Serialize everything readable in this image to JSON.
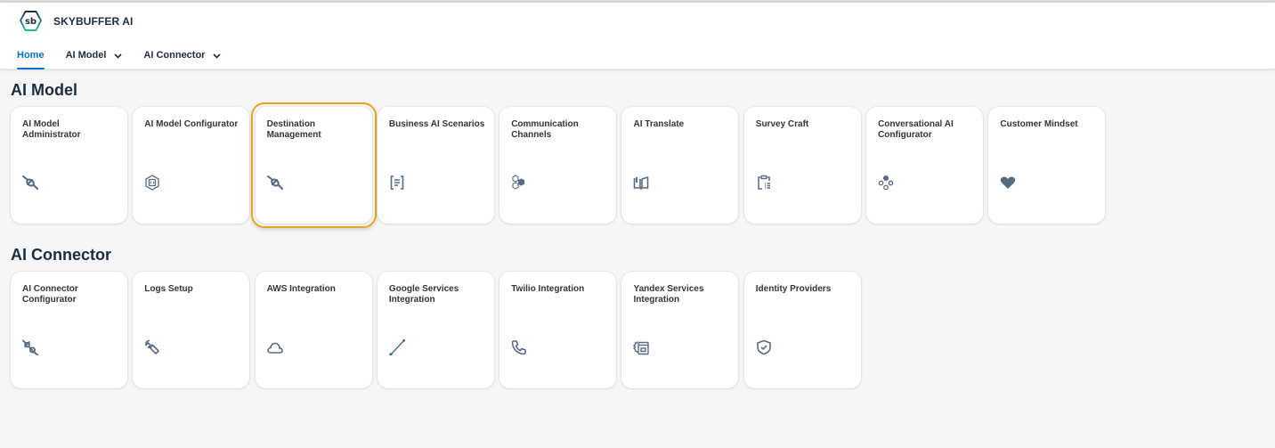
{
  "app": {
    "title": "SKYBUFFER AI",
    "logo_text": "sb"
  },
  "nav": {
    "items": [
      {
        "label": "Home",
        "active": true,
        "has_menu": false
      },
      {
        "label": "AI Model",
        "active": false,
        "has_menu": true
      },
      {
        "label": "AI Connector",
        "active": false,
        "has_menu": true
      }
    ]
  },
  "colors": {
    "accent": "#0a6ed1",
    "focus": "#e9a41c",
    "icon": "#556b82",
    "text": "#1d2d3e",
    "background": "#f5f6f7",
    "tile": "#ffffff"
  },
  "sections": [
    {
      "title": "AI Model",
      "tiles": [
        {
          "title": "AI Model Administrator",
          "icon": "plug-disconnected-icon"
        },
        {
          "title": "AI Model Configurator",
          "icon": "hexagon-code-icon"
        },
        {
          "title": "Destination Management",
          "icon": "plug-disconnected-icon",
          "focused": true
        },
        {
          "title": "Business AI Scenarios",
          "icon": "document-text-bracket-icon"
        },
        {
          "title": "Communication Channels",
          "icon": "hexagons-network-icon"
        },
        {
          "title": "AI Translate",
          "icon": "open-book-icon"
        },
        {
          "title": "Survey Craft",
          "icon": "clipboard-list-icon"
        },
        {
          "title": "Conversational AI Configurator",
          "icon": "nodes-cluster-icon"
        },
        {
          "title": "Customer Mindset",
          "icon": "heart-icon"
        }
      ]
    },
    {
      "title": "AI Connector",
      "tiles": [
        {
          "title": "AI Connector Configurator",
          "icon": "plug-connected-icon"
        },
        {
          "title": "Logs Setup",
          "icon": "wrench-icon"
        },
        {
          "title": "AWS Integration",
          "icon": "cloud-icon"
        },
        {
          "title": "Google Services Integration",
          "icon": "line-segment-icon"
        },
        {
          "title": "Twilio Integration",
          "icon": "phone-icon"
        },
        {
          "title": "Yandex Services Integration",
          "icon": "gear-window-icon"
        },
        {
          "title": "Identity Providers",
          "icon": "shield-check-icon"
        }
      ]
    }
  ]
}
